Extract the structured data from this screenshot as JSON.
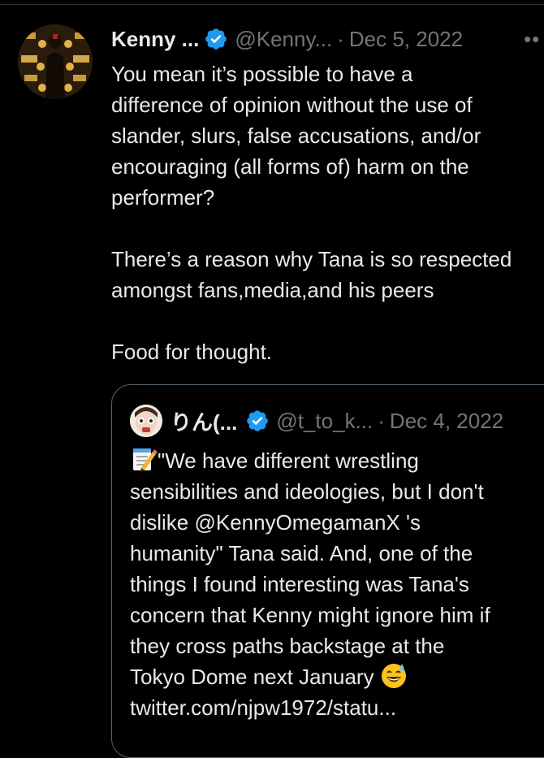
{
  "tweet": {
    "author_name": "Kenny ...",
    "handle": "@Kenny...",
    "separator": "·",
    "date": "Dec 5, 2022",
    "more_label": "••",
    "text": "You mean it’s possible to have a\ndifference of opinion without the use of\nslander, slurs, false accusations, and/or\nencouraging (all forms of) harm on the\nperformer?\n\nThere’s a reason why Tana is so respected\namongst fans,media,and his peers\n\nFood for thought.",
    "avatar_icon": "avatar-photo",
    "verified_icon": "verified-badge-icon"
  },
  "quote": {
    "author_name": "りん(...",
    "handle": "@t_to_k...",
    "separator": "·",
    "date": "Dec 4, 2022",
    "text_main": "\"We have different wrestling\nsensibilities and ideologies, but I don't\ndislike @KennyOmegamanX 's\nhumanity\" Tana said. And, one of the\nthings I found interesting was Tana's\nconcern that Kenny might ignore him if\nthey cross paths backstage at the\nTokyo Dome next January ",
    "link": "twitter.com/njpw1972/statu...",
    "lead_icon": "memo-icon",
    "trailing_icon": "grinning-sweat-emoji-icon"
  },
  "colors": {
    "background": "#000000",
    "text": "#e7e9ea",
    "secondary_text": "#71767b",
    "verified": "#1d9bf0",
    "border": "#536471"
  }
}
